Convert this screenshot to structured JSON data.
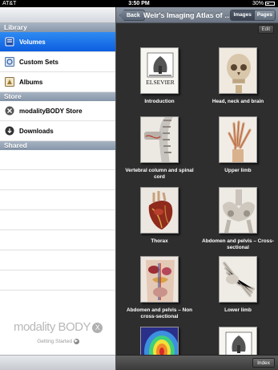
{
  "status_bar": {
    "carrier": "AT&T",
    "time": "3:50 PM",
    "battery": "30%"
  },
  "sidebar": {
    "sections": [
      {
        "title": "Library",
        "items": [
          {
            "label": "Volumes",
            "icon": "book-icon",
            "selected": true
          },
          {
            "label": "Custom Sets",
            "icon": "custom-sets-icon",
            "selected": false
          },
          {
            "label": "Albums",
            "icon": "album-icon",
            "selected": false
          }
        ]
      },
      {
        "title": "Store",
        "items": [
          {
            "label": "modalityBODY Store",
            "icon": "modality-store-icon",
            "selected": false
          },
          {
            "label": "Downloads",
            "icon": "download-icon",
            "selected": false
          }
        ]
      },
      {
        "title": "Shared",
        "items": []
      }
    ],
    "brand": {
      "word1": "modality",
      "word2": "BODY",
      "mark": "X"
    },
    "getting_started": "Getting Started"
  },
  "navbar": {
    "back_label": "Back",
    "title": "Weir's Imaging Atlas of Human Anatomy",
    "segments": [
      {
        "label": "Images",
        "active": true
      },
      {
        "label": "Pages",
        "active": false
      }
    ]
  },
  "edit_label": "Edit",
  "chapters": [
    {
      "label": "Introduction",
      "thumb": "elsevier"
    },
    {
      "label": "Head, neck and brain",
      "thumb": "skull"
    },
    {
      "label": "Vertebral column and spinal cord",
      "thumb": "spine"
    },
    {
      "label": "Upper limb",
      "thumb": "hand"
    },
    {
      "label": "Thorax",
      "thumb": "heart"
    },
    {
      "label": "Abdomen and pelvis – Cross-sectional",
      "thumb": "pelvis"
    },
    {
      "label": "Abdomen and pelvis – Non cross-sectional",
      "thumb": "abdomen"
    },
    {
      "label": "Lower limb",
      "thumb": "foot"
    },
    {
      "label": "",
      "thumb": "heatmap"
    },
    {
      "label": "",
      "thumb": "elsevier2"
    }
  ],
  "thumb_text": {
    "publisher": "ELSEVIER"
  },
  "index_label": "Index",
  "colors": {
    "selected_row": "#1a6fe8",
    "section_header": "#94a2b5",
    "content_bg": "#2e2e2e"
  }
}
